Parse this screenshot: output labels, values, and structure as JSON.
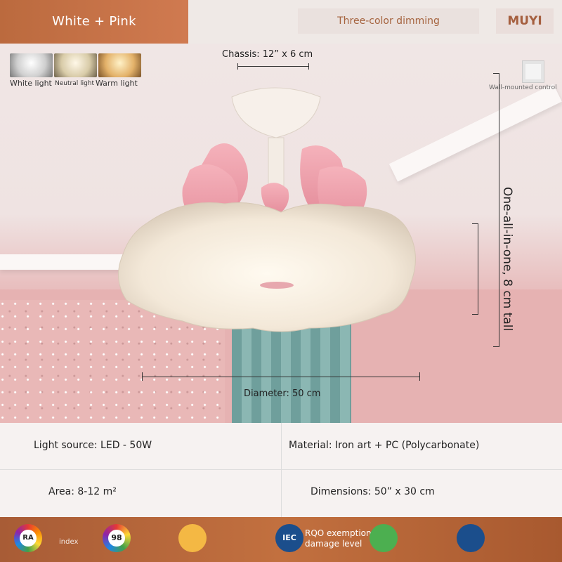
{
  "header": {
    "color_variant": "White + Pink",
    "dimming_mode": "Three-color dimming",
    "brand": "MUYI"
  },
  "light_modes": [
    {
      "label": "White light",
      "color": "#e9e9e9"
    },
    {
      "label": "Neutral light",
      "color": "#f3e6c8"
    },
    {
      "label": "Warm light",
      "color": "#f1c77c"
    }
  ],
  "wall_control": {
    "label": "Wall-mounted control"
  },
  "dimensions": {
    "chassis": "Chassis: 12” x 6 cm",
    "height": "One-all-in-one, 8 cm tall",
    "diameter": "Diameter: 50 cm"
  },
  "specs": {
    "light_source": "Light source: LED - 50W",
    "material": "Material: Iron art + PC (Polycarbonate)",
    "area": "Area: 8-12 m²",
    "dimensions": "Dimensions: 50” x 30 cm"
  },
  "badges": [
    {
      "icon": "ra-icon",
      "title": "RA",
      "caption": "index"
    },
    {
      "icon": "score-98-icon",
      "title": "98",
      "caption": ""
    },
    {
      "icon": "flicker-free-icon",
      "title": "",
      "caption": ""
    },
    {
      "icon": "iec-icon",
      "title": "IEC",
      "caption": "RQO exemption damage level"
    },
    {
      "icon": "eye-care-icon",
      "title": "",
      "caption": ""
    },
    {
      "icon": "certification-icon",
      "title": "",
      "caption": ""
    }
  ],
  "colors": {
    "accent": "#c46d43",
    "footer": "#b0623a",
    "pink": "#ec9ca8",
    "shade": "#f7eee2"
  }
}
